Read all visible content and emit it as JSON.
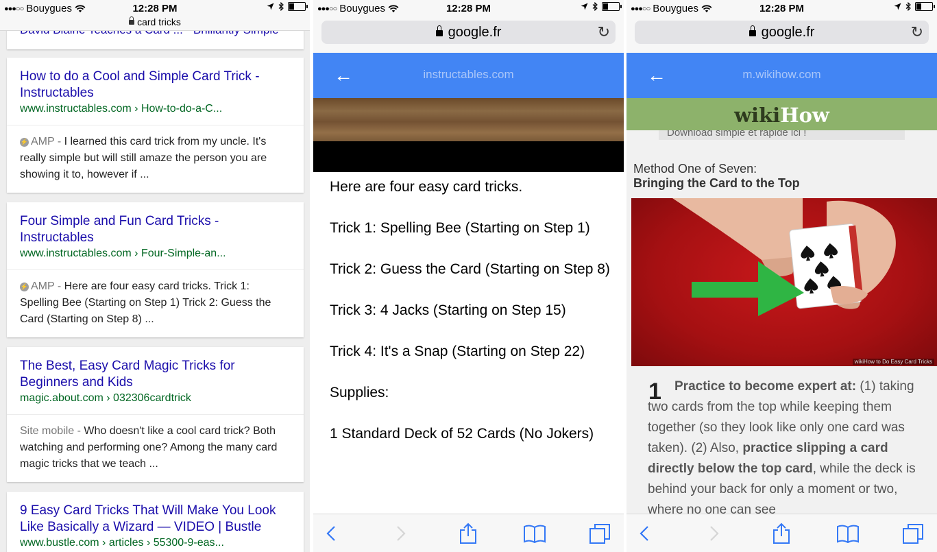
{
  "status": {
    "carrier": "Bouygues",
    "signal": "●●●○○",
    "time": "12:28 PM"
  },
  "panel1": {
    "query": "card tricks",
    "partial_title": "David Blaine Teaches a Card ... - Brilliantly Simple",
    "results": [
      {
        "title": "How to do a Cool and Simple Card Trick - Instructables",
        "url": "www.instructables.com › How-to-do-a-C...",
        "tag": "AMP -",
        "snippet": "I learned this card trick from my uncle. It's really simple but will still amaze the person you are showing it to, however if ..."
      },
      {
        "title": "Four Simple and Fun Card Tricks - Instructables",
        "url": "www.instructables.com › Four-Simple-an...",
        "tag": "AMP -",
        "snippet": "Here are four easy card tricks. Trick 1: Spelling Bee (Starting on Step 1) Trick 2: Guess the Card (Starting on Step 8) ..."
      },
      {
        "title": "The Best, Easy Card Magic Tricks for Beginners and Kids",
        "url": "magic.about.com › 032306cardtrick",
        "tag": "Site mobile -",
        "snippet": "Who doesn't like a cool card trick? Both watching and performing one? Among the many card magic tricks that we teach ..."
      },
      {
        "title": "9 Easy Card Tricks That Will Make You Look Like Basically a Wizard — VIDEO | Bustle",
        "url": "www.bustle.com › articles › 55300-9-eas..."
      }
    ]
  },
  "panel2": {
    "address": "google.fr",
    "amp_domain": "instructables.com",
    "paragraphs": [
      "Here are four easy card tricks.",
      "Trick 1: Spelling Bee (Starting on Step 1)",
      "Trick 2: Guess the Card (Starting on Step 8)",
      "Trick 3: 4 Jacks (Starting on Step 15)",
      "Trick 4: It's a Snap (Starting on Step 22)",
      "Supplies:",
      "1 Standard Deck of 52 Cards (No Jokers)"
    ]
  },
  "panel3": {
    "address": "google.fr",
    "amp_domain": "m.wikihow.com",
    "logo_a": "wiki",
    "logo_b": "How",
    "download_text": "Download simple et rapide ici !",
    "method_label": "Method One of Seven:",
    "method_title": "Bringing the Card to the Top",
    "image_caption": "wikiHow to Do Easy Card Tricks",
    "step_number": "1",
    "step": {
      "b1": "Practice to become expert at:",
      "t1": " (1) taking two cards from the top while keeping them together (so they look like only one card was taken). (2) Also, ",
      "b2": "practice slipping a card directly below the top card",
      "t2": ", while the deck is behind your back for only a moment or two, where no one can see"
    }
  },
  "colors": {
    "amp_blue": "#4285f4",
    "link_blue": "#1a0dab",
    "url_green": "#006621",
    "wikihow_green": "#8db26b"
  },
  "icons": [
    "wifi-icon",
    "location-arrow-icon",
    "bluetooth-icon",
    "battery-icon",
    "lock-icon",
    "reload-icon",
    "back-arrow-icon",
    "chevron-left-icon",
    "chevron-right-icon",
    "share-icon",
    "bookmarks-icon",
    "tabs-icon"
  ]
}
